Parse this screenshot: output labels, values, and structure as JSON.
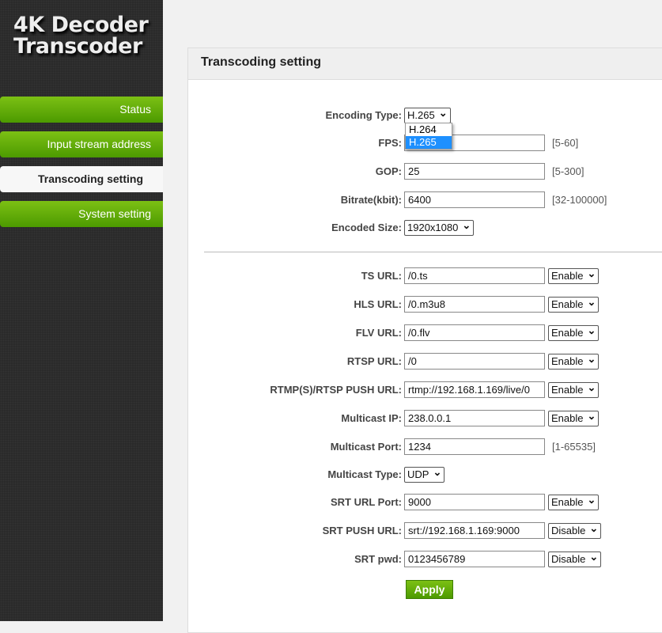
{
  "logo": {
    "line1": "4K Decoder",
    "line2": "Transcoder"
  },
  "nav": [
    {
      "label": "Status"
    },
    {
      "label": "Input stream address"
    },
    {
      "label": "Transcoding setting"
    },
    {
      "label": "System setting"
    }
  ],
  "panel": {
    "title": "Transcoding setting"
  },
  "encoding": {
    "label": "Encoding Type:",
    "value": "H.265",
    "options": [
      "H.264",
      "H.265"
    ]
  },
  "fps": {
    "label": "FPS:",
    "value": "",
    "hint": "[5-60]"
  },
  "gop": {
    "label": "GOP:",
    "value": "25",
    "hint": "[5-300]"
  },
  "bitrate": {
    "label": "Bitrate(kbit):",
    "value": "6400",
    "hint": "[32-100000]"
  },
  "size": {
    "label": "Encoded Size:",
    "value": "1920x1080"
  },
  "urls": [
    {
      "label": "TS URL:",
      "value": "/0.ts",
      "state": "Enable"
    },
    {
      "label": "HLS URL:",
      "value": "/0.m3u8",
      "state": "Enable"
    },
    {
      "label": "FLV URL:",
      "value": "/0.flv",
      "state": "Enable"
    },
    {
      "label": "RTSP URL:",
      "value": "/0",
      "state": "Enable"
    },
    {
      "label": "RTMP(S)/RTSP PUSH URL:",
      "value": "rtmp://192.168.1.169/live/0",
      "state": "Enable"
    },
    {
      "label": "Multicast IP:",
      "value": "238.0.0.1",
      "state": "Enable"
    }
  ],
  "mport": {
    "label": "Multicast Port:",
    "value": "1234",
    "hint": "[1-65535]"
  },
  "mtype": {
    "label": "Multicast Type:",
    "value": "UDP"
  },
  "srt": [
    {
      "label": "SRT URL Port:",
      "value": "9000",
      "state": "Enable"
    },
    {
      "label": "SRT PUSH URL:",
      "value": "srt://192.168.1.169:9000",
      "state": "Disable"
    },
    {
      "label": "SRT pwd:",
      "value": "0123456789",
      "state": "Disable"
    }
  ],
  "apply": "Apply"
}
